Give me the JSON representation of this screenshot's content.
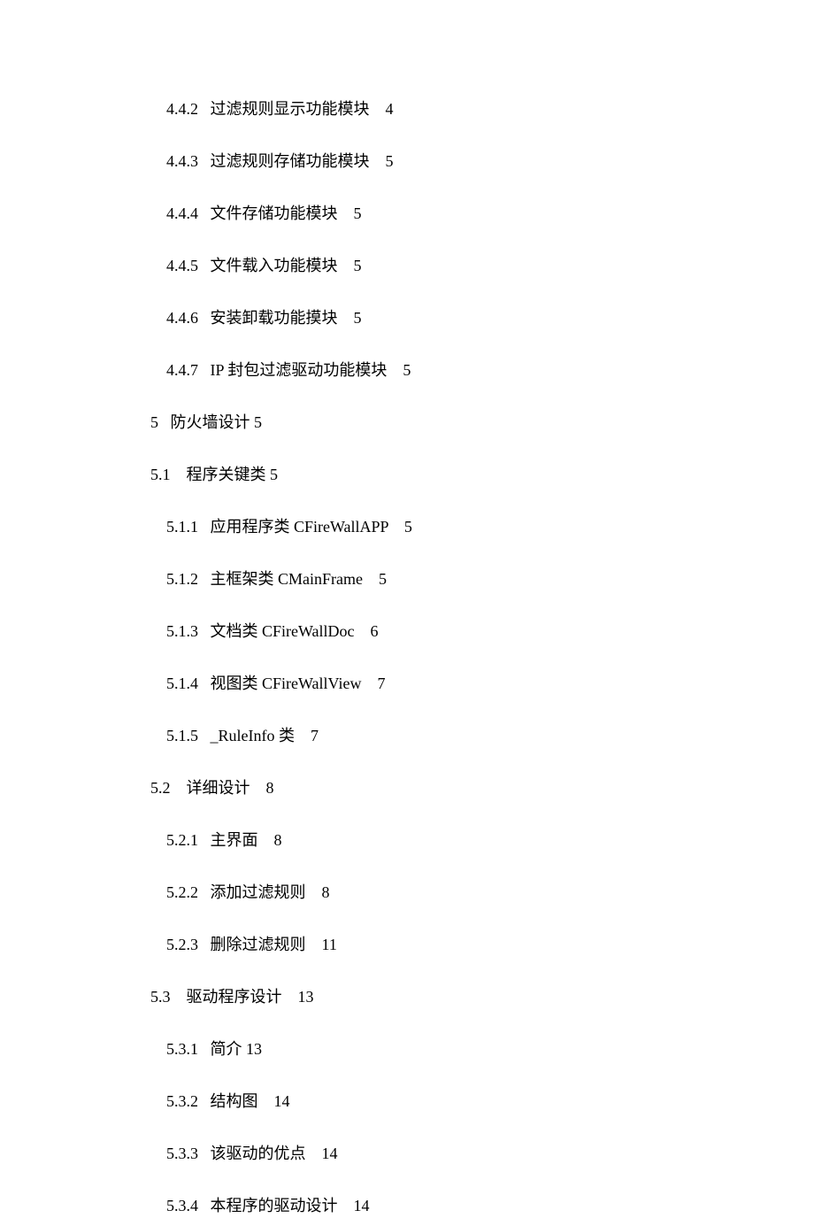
{
  "toc": [
    {
      "level": 2,
      "number": "4.4.2",
      "title": "过滤规则显示功能模块",
      "page": "4"
    },
    {
      "level": 2,
      "number": "4.4.3",
      "title": "过滤规则存储功能模块",
      "page": "5"
    },
    {
      "level": 2,
      "number": "4.4.4",
      "title": "文件存储功能模块",
      "page": "5"
    },
    {
      "level": 2,
      "number": "4.4.5",
      "title": "文件载入功能模块",
      "page": "5"
    },
    {
      "level": 2,
      "number": "4.4.6",
      "title": "安装卸载功能摸块",
      "page": "5"
    },
    {
      "level": 2,
      "number": "4.4.7",
      "title": "IP 封包过滤驱动功能模块",
      "page": "5"
    },
    {
      "level": 0,
      "number": "5",
      "title": "防火墙设计",
      "page": "5"
    },
    {
      "level": 1,
      "number": "5.1",
      "title": "程序关键类",
      "page": "5"
    },
    {
      "level": 2,
      "number": "5.1.1",
      "title": "应用程序类 CFireWallAPP",
      "page": "5"
    },
    {
      "level": 2,
      "number": "5.1.2",
      "title": "主框架类 CMainFrame",
      "page": "5"
    },
    {
      "level": 2,
      "number": "5.1.3",
      "title": "文档类 CFireWallDoc",
      "page": "6"
    },
    {
      "level": 2,
      "number": "5.1.4",
      "title": "视图类 CFireWallView",
      "page": "7"
    },
    {
      "level": 2,
      "number": "5.1.5",
      "title": "_RuleInfo 类",
      "page": "7"
    },
    {
      "level": 1,
      "number": "5.2",
      "title": "详细设计",
      "page": "8"
    },
    {
      "level": 2,
      "number": "5.2.1",
      "title": "主界面",
      "page": "8"
    },
    {
      "level": 2,
      "number": "5.2.2",
      "title": "添加过滤规则",
      "page": "8"
    },
    {
      "level": 2,
      "number": "5.2.3",
      "title": "删除过滤规则",
      "page": "11"
    },
    {
      "level": 1,
      "number": "5.3",
      "title": "驱动程序设计",
      "page": "13"
    },
    {
      "level": 2,
      "number": "5.3.1",
      "title": "简介",
      "page": "13"
    },
    {
      "level": 2,
      "number": "5.3.2",
      "title": "结构图",
      "page": "14"
    },
    {
      "level": 2,
      "number": "5.3.3",
      "title": "该驱动的优点",
      "page": "14"
    },
    {
      "level": 2,
      "number": "5.3.4",
      "title": "本程序的驱动设计",
      "page": "14"
    }
  ]
}
